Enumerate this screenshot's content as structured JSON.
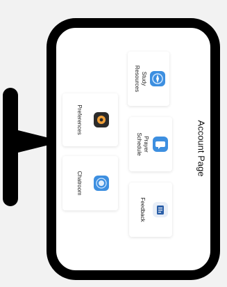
{
  "page": {
    "title": "Account Page"
  },
  "cards": {
    "study_resources": {
      "label": "Study\nResources",
      "icon": "compass-icon"
    },
    "prayer_schedule": {
      "label": "Prayer\nSchedule",
      "icon": "chat-bubble-icon"
    },
    "feedback": {
      "label": "Feedback",
      "icon": "document-icon"
    },
    "preferences": {
      "label": "Preferences",
      "icon": "settings-app-icon"
    },
    "chatroom": {
      "label": "Chatroom",
      "icon": "chat-app-icon"
    }
  },
  "colors": {
    "frame": "#000000",
    "screen": "#ffffff",
    "icon_blue": "#3d8fe0",
    "icon_dark": "#2b2b2b",
    "icon_orange": "#f0a03a"
  }
}
